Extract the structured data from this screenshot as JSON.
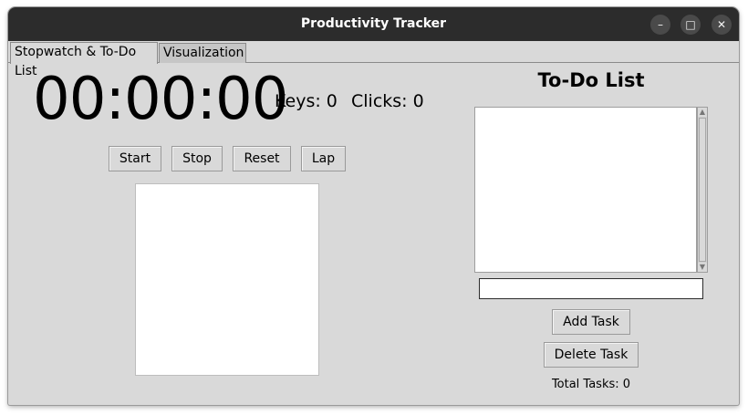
{
  "window": {
    "title": "Productivity Tracker",
    "controls": {
      "minimize_glyph": "–",
      "maximize_glyph": "□",
      "close_glyph": "✕"
    }
  },
  "tabs": [
    {
      "label": "Stopwatch & To-Do List",
      "active": true
    },
    {
      "label": "Visualization",
      "active": false
    }
  ],
  "stopwatch": {
    "time": "00:00:00",
    "keys_label": "Keys: 0",
    "clicks_label": "Clicks: 0",
    "buttons": {
      "start": "Start",
      "stop": "Stop",
      "reset": "Reset",
      "lap": "Lap"
    },
    "laps": []
  },
  "todo": {
    "title": "To-Do List",
    "tasks": [],
    "new_task_value": "",
    "add_label": "Add Task",
    "delete_label": "Delete Task",
    "total_label": "Total Tasks: 0"
  },
  "icons": [
    "minimize-icon",
    "maximize-icon",
    "close-icon",
    "scroll-up-arrow-icon",
    "scroll-down-arrow-icon"
  ]
}
